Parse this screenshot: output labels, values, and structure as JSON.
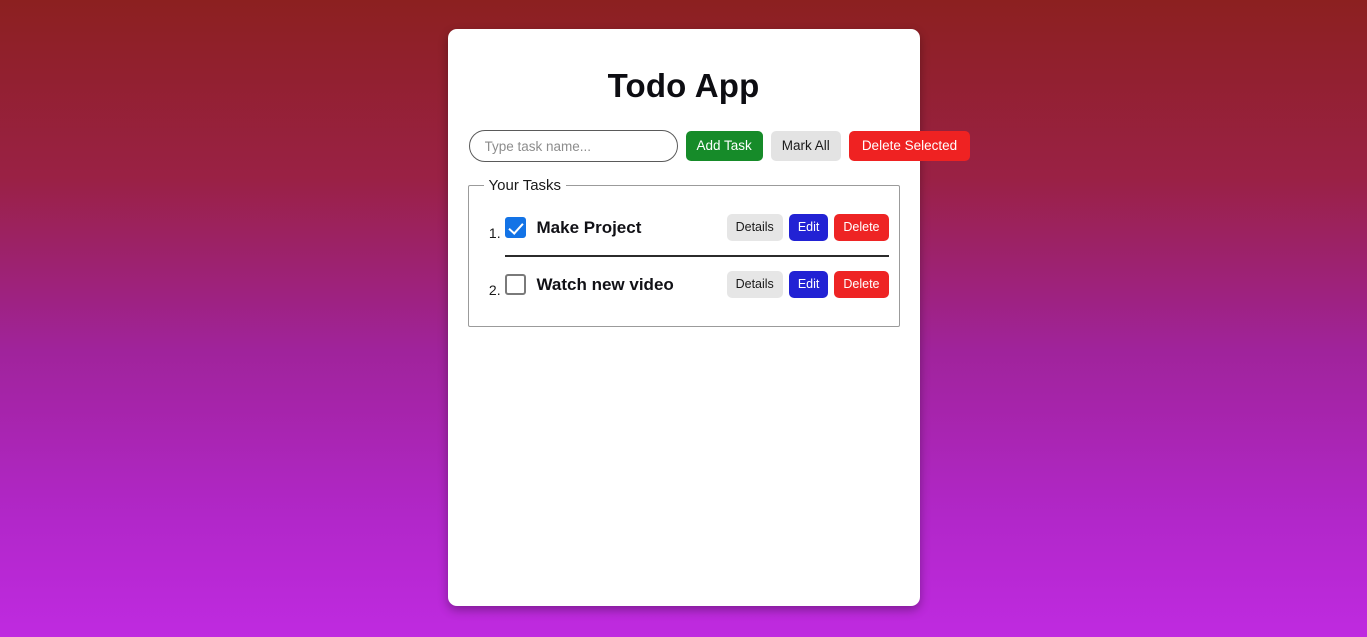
{
  "app": {
    "title": "Todo App",
    "background_top_color": "#8c2020",
    "background_bottom_color": "#bf2ae0",
    "card_background": "#ffffff"
  },
  "controls": {
    "input_placeholder": "Type task name...",
    "input_value": "",
    "add_label": "Add Task",
    "add_color": "#168b29",
    "mark_all_label": "Mark All",
    "mark_all_color": "#e3e3e3",
    "delete_selected_label": "Delete Selected",
    "delete_selected_color": "#ef2222"
  },
  "tasks_section": {
    "legend": "Your Tasks",
    "row_buttons": {
      "details_label": "Details",
      "edit_label": "Edit",
      "delete_label": "Delete",
      "details_color": "#e6e6e6",
      "edit_color": "#2222d4",
      "delete_color": "#ee2424"
    },
    "items": [
      {
        "number": "1.",
        "label": "Make Project",
        "checked": true
      },
      {
        "number": "2.",
        "label": "Watch new video",
        "checked": false
      }
    ]
  }
}
